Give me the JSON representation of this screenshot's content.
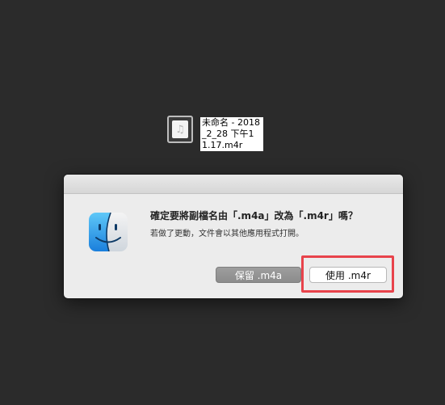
{
  "desktop": {
    "file": {
      "icon": "music-note-icon",
      "name": "未命名 - 2018_2_28 下午11.17.m4r"
    }
  },
  "dialog": {
    "icon": "finder-icon",
    "message": "確定要將副檔名由「.m4a」改為「.m4r」嗎？",
    "info": "若做了更動，文件會以其他應用程式打開。",
    "buttons": {
      "keep": "保留 .m4a",
      "use": "使用 .m4r"
    }
  },
  "annotation": {
    "highlight_color": "#e8434b"
  }
}
